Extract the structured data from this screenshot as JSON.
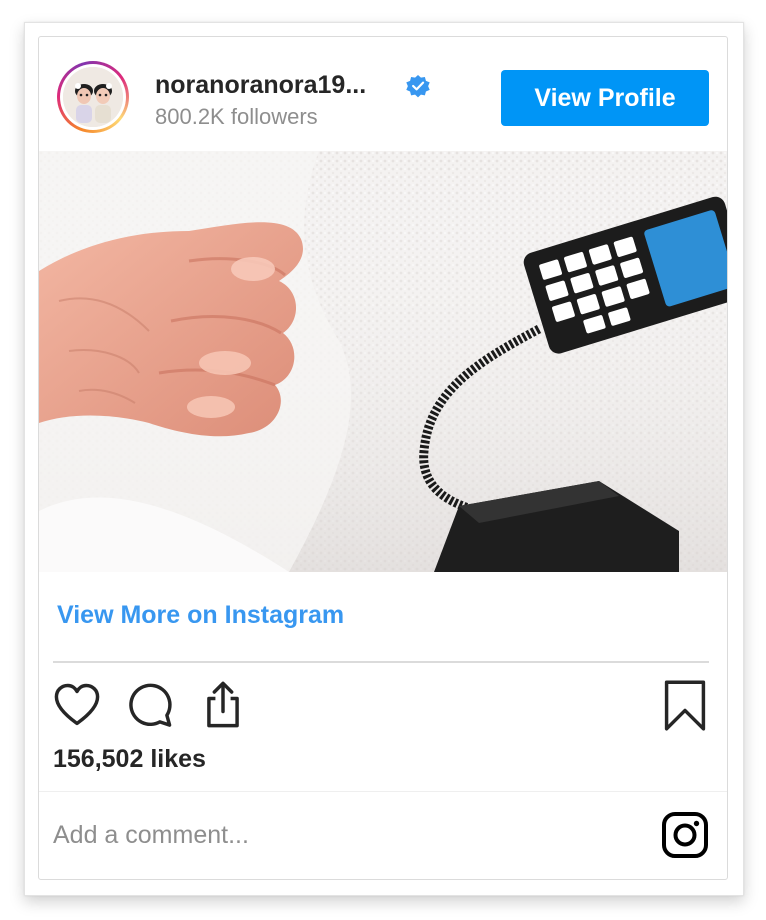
{
  "post": {
    "username": "noranoranora19...",
    "followers": "800.2K followers",
    "view_profile_label": "View Profile",
    "view_more_label": "View More on Instagram",
    "likes": "156,502 likes",
    "comment_placeholder": "Add a comment..."
  },
  "icons": {
    "verified": "verified-badge-icon",
    "like": "heart-icon",
    "comment": "comment-bubble-icon",
    "share": "share-icon",
    "save": "bookmark-icon",
    "brand": "instagram-icon"
  },
  "colors": {
    "accent": "#0095f6",
    "link": "#3897f0",
    "text": "#262626",
    "muted": "#8e8e8e",
    "border": "#dbdbdb"
  }
}
